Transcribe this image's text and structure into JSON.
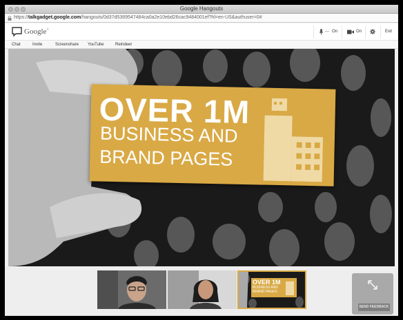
{
  "window": {
    "title": "Google Hangouts"
  },
  "address_bar": {
    "url_prefix": "https://",
    "url_host": "talkgadget.google.com",
    "url_path": "/hangouts/0d37d5369547484ca0a2e10ebd26cac9484001ef?hl=en-US&authuser=0#"
  },
  "header": {
    "logo_text": "Google",
    "logo_plus": "+",
    "mic_state": "On",
    "camera_state": "On",
    "exit_label": "Exit"
  },
  "tabs": [
    {
      "label": "Chat"
    },
    {
      "label": "Invite"
    },
    {
      "label": "Screenshare"
    },
    {
      "label": "YouTube"
    },
    {
      "label": "Reindeer"
    }
  ],
  "main_video": {
    "card_line1": "OVER 1M",
    "card_line2": "BUSINESS AND",
    "card_line3": "BRAND PAGES"
  },
  "thumbnails": [
    {
      "name": "participant-1"
    },
    {
      "name": "participant-2"
    },
    {
      "name": "shared-card",
      "line1": "OVER 1M",
      "line2": "BUSINESS AND",
      "line3": "BRAND PAGES",
      "active": true
    }
  ],
  "feedback": {
    "label": "SEND FEEDBACK"
  },
  "colors": {
    "card": "#d9a945",
    "accent_active": "#d9a945"
  }
}
